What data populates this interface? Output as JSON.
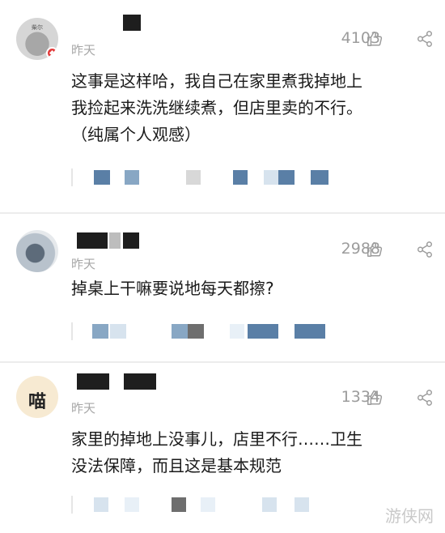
{
  "comments": [
    {
      "avatar_text": "柴尔",
      "time": "昨天",
      "likes": "4103",
      "body_lines": [
        "这事是这样哈，我自己在家里煮我掉地上",
        "我捡起来洗洗继续煮，但店里卖的不行。",
        "（纯属个人观感）"
      ]
    },
    {
      "time": "昨天",
      "likes": "2988",
      "body_lines": [
        "掉桌上干嘛要说地每天都擦?"
      ]
    },
    {
      "avatar_text": "喵",
      "time": "昨天",
      "likes": "1334",
      "body_lines": [
        "家里的掉地上没事儿，店里不行……卫生",
        "没法保障，而且这是基本规范"
      ]
    }
  ],
  "icons": {
    "like": "thumbs-up-icon",
    "share": "share-icon"
  },
  "colors": {
    "text": "#1a1a1a",
    "meta": "#a7a7a7",
    "reply_blue": "#5a7fa6"
  },
  "watermark": "游侠网"
}
